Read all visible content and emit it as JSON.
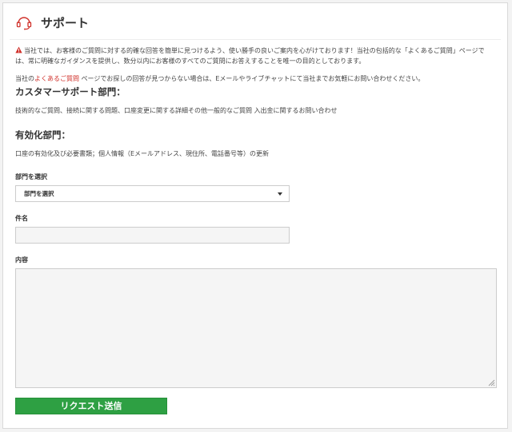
{
  "header": {
    "title": "サポート",
    "icon": "headset-icon"
  },
  "notice": {
    "icon": "warning-icon",
    "text": "当社では、お客様のご質問に対する的確な回答を簡単に見つけるよう、使い勝手の良いご案内を心がけております！当社の包括的な「よくあるご質問」ページでは、常に明確なガイダンスを提供し、数分以内にお客様のすべてのご質問にお答えすることを唯一の目的としております。"
  },
  "faq_line": {
    "prefix": "当社の",
    "link": "よくあるご質問",
    "suffix": " ページでお探しの回答が見つからない場合は、Eメールやライブチャットにて当社までお気軽にお問い合わせください。"
  },
  "sections": {
    "customer_support": {
      "title": "カスタマーサポート部門：",
      "desc": "技術的なご質問、接続に関する問題、口座変更に関する詳細その他一般的なご質問 入出金に関するお問い合わせ"
    },
    "verification": {
      "title": "有効化部門：",
      "desc": "口座の有効化及び必要書類；個人情報（Eメールアドレス、現住所、電話番号等）の更新"
    }
  },
  "form": {
    "department_label": "部門を選択",
    "department_selected": "部門を選択",
    "subject_label": "件名",
    "subject_value": "",
    "content_label": "内容",
    "content_value": "",
    "submit_label": "リクエスト送信"
  },
  "colors": {
    "accent_red": "#d0302a",
    "submit_green": "#2ea043"
  }
}
